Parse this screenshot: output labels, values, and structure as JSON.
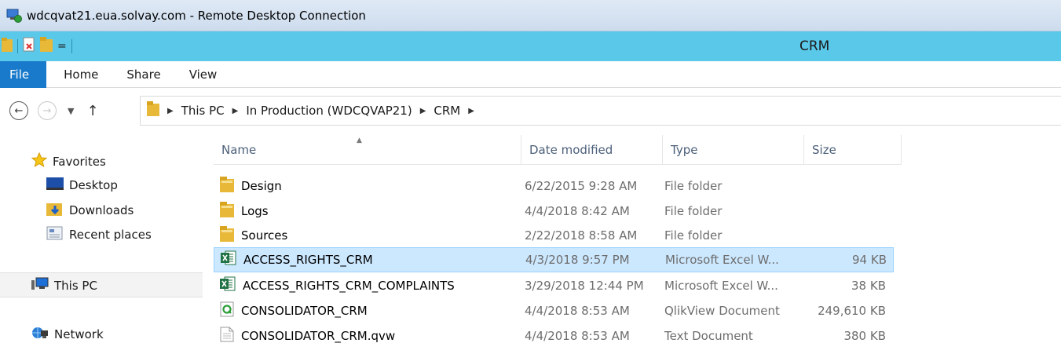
{
  "window": {
    "title": "wdcqvat21.eua.solvay.com - Remote Desktop Connection"
  },
  "explorer": {
    "title": "CRM"
  },
  "ribbon": {
    "tabs": [
      "File",
      "Home",
      "Share",
      "View"
    ]
  },
  "address": {
    "breadcrumbs": [
      "This PC",
      "In Production (WDCQVAP21)",
      "CRM"
    ]
  },
  "nav": {
    "favorites": "Favorites",
    "desktop": "Desktop",
    "downloads": "Downloads",
    "recent": "Recent places",
    "this_pc": "This PC",
    "network": "Network"
  },
  "columns": {
    "name": "Name",
    "date": "Date modified",
    "type": "Type",
    "size": "Size"
  },
  "files": [
    {
      "name": "Design",
      "date": "6/22/2015 9:28 AM",
      "type": "File folder",
      "size": "",
      "icon": "folder-icon"
    },
    {
      "name": "Logs",
      "date": "4/4/2018 8:42 AM",
      "type": "File folder",
      "size": "",
      "icon": "folder-icon"
    },
    {
      "name": "Sources",
      "date": "2/22/2018 8:58 AM",
      "type": "File folder",
      "size": "",
      "icon": "folder-icon"
    },
    {
      "name": "ACCESS_RIGHTS_CRM",
      "date": "4/3/2018 9:57 PM",
      "type": "Microsoft Excel W...",
      "size": "94 KB",
      "icon": "excel-icon",
      "selected": true
    },
    {
      "name": "ACCESS_RIGHTS_CRM_COMPLAINTS",
      "date": "3/29/2018 12:44 PM",
      "type": "Microsoft Excel W...",
      "size": "38 KB",
      "icon": "excel-icon"
    },
    {
      "name": "CONSOLIDATOR_CRM",
      "date": "4/4/2018 8:53 AM",
      "type": "QlikView Document",
      "size": "249,610 KB",
      "icon": "qlikview-icon"
    },
    {
      "name": "CONSOLIDATOR_CRM.qvw",
      "date": "4/4/2018 8:53 AM",
      "type": "Text Document",
      "size": "380 KB",
      "icon": "text-document-icon"
    }
  ]
}
